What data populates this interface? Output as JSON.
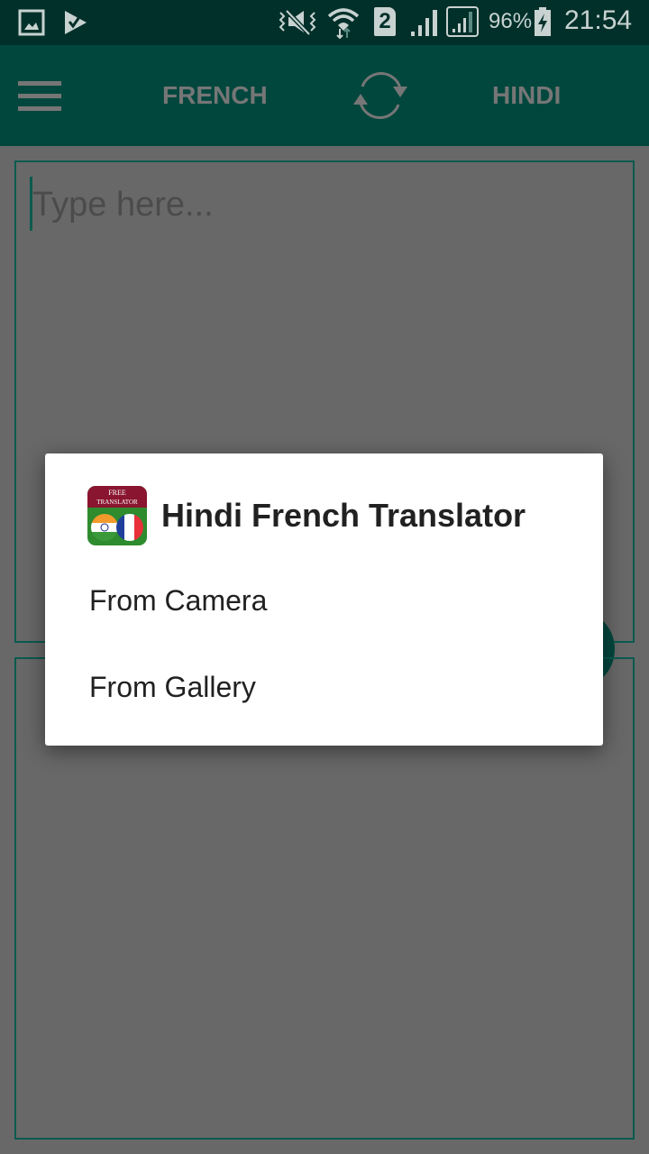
{
  "status_bar": {
    "icons": [
      "gallery-icon",
      "task-check-icon",
      "mute-vibrate-icon",
      "wifi-icon",
      "sim-2-icon",
      "signal-icon",
      "signal-roaming-icon",
      "battery-charging-icon"
    ],
    "sim_label": "2",
    "battery": "96%",
    "time": "21:54"
  },
  "toolbar": {
    "source_language": "FRENCH",
    "target_language": "HINDI",
    "menu_icon": "hamburger-menu-icon",
    "swap_icon": "swap-languages-icon",
    "color": "#01473e"
  },
  "input": {
    "placeholder": "Type here...",
    "value": ""
  },
  "dialog": {
    "title": "Hindi French Translator",
    "app_icon": {
      "line1": "FREE",
      "line2": "TRANSLATOR"
    },
    "items": [
      {
        "label": "From Camera"
      },
      {
        "label": "From Gallery"
      }
    ]
  }
}
